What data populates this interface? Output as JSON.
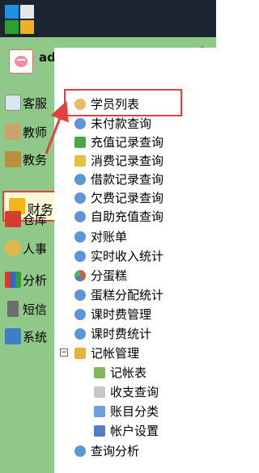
{
  "header": {
    "logo_icon": "windows-logo-icon"
  },
  "user": {
    "name": "admin",
    "caret": "▼",
    "pin": "ᵖ"
  },
  "nav": {
    "items": [
      {
        "label": "客服",
        "icon": "notebook-icon"
      },
      {
        "label": "教师",
        "icon": "book-icon"
      },
      {
        "label": "教务",
        "icon": "scale-icon"
      },
      {
        "label": "财务",
        "icon": "money-icon"
      },
      {
        "label": "仓库",
        "icon": "house-icon"
      },
      {
        "label": "人事",
        "icon": "person-icon"
      },
      {
        "label": "分析",
        "icon": "bar-chart-icon"
      },
      {
        "label": "短信",
        "icon": "phone-icon"
      },
      {
        "label": "系统",
        "icon": "settings-icon"
      }
    ]
  },
  "tree": {
    "items": [
      {
        "label": "学员列表",
        "icon": "users-icon"
      },
      {
        "label": "未付款查询",
        "icon": "search-icon"
      },
      {
        "label": "充值记录查询",
        "icon": "arrow-icon"
      },
      {
        "label": "消费记录查询",
        "icon": "arrow-icon"
      },
      {
        "label": "借款记录查询",
        "icon": "search-icon"
      },
      {
        "label": "欠费记录查询",
        "icon": "search-icon"
      },
      {
        "label": "自助充值查询",
        "icon": "search-icon"
      },
      {
        "label": "对账单",
        "icon": "search-icon"
      },
      {
        "label": "实时收入统计",
        "icon": "search-icon"
      },
      {
        "label": "分蛋糕",
        "icon": "pie-icon"
      },
      {
        "label": "蛋糕分配统计",
        "icon": "search-icon"
      },
      {
        "label": "课时费管理",
        "icon": "search-icon"
      },
      {
        "label": "课时费统计",
        "icon": "search-icon"
      },
      {
        "label": "记帐管理",
        "icon": "folder-icon",
        "toggle": "−"
      },
      {
        "label": "记帐表",
        "icon": "add-icon"
      },
      {
        "label": "收支查询",
        "icon": "coin-icon"
      },
      {
        "label": "账目分类",
        "icon": "monitor-icon"
      },
      {
        "label": "帐户设置",
        "icon": "account-icon"
      },
      {
        "label": "查询分析",
        "icon": "search-icon"
      }
    ]
  }
}
